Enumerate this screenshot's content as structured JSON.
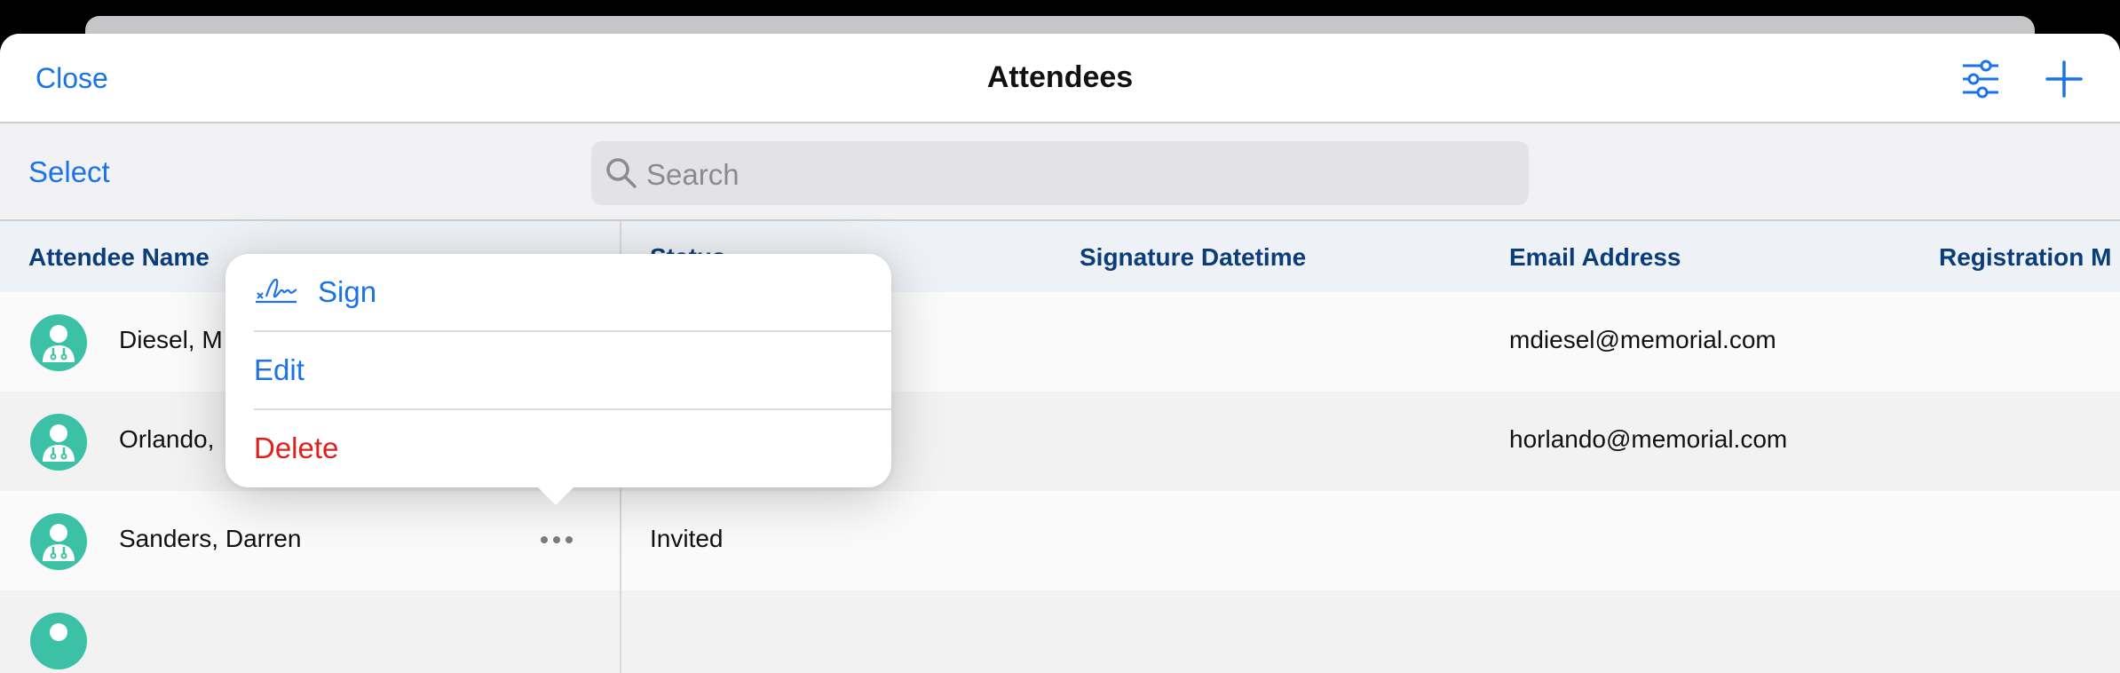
{
  "nav": {
    "close_label": "Close",
    "title": "Attendees"
  },
  "toolbar": {
    "select_label": "Select",
    "search_placeholder": "Search"
  },
  "table": {
    "columns": [
      "Attendee Name",
      "Status",
      "Signature Datetime",
      "Email Address",
      "Registration M"
    ],
    "rows": [
      {
        "name": "Diesel, M",
        "status": "",
        "signature": "",
        "email": "mdiesel@memorial.com"
      },
      {
        "name": "Orlando,",
        "status": "",
        "signature": "",
        "email": "horlando@memorial.com"
      },
      {
        "name": "Sanders, Darren",
        "status": "Invited",
        "signature": "",
        "email": ""
      }
    ]
  },
  "menu": {
    "sign_label": "Sign",
    "edit_label": "Edit",
    "delete_label": "Delete"
  },
  "colors": {
    "accent": "#1a73e8",
    "header_text": "#0a3d7a",
    "danger": "#e0201a",
    "avatar": "#3cc0a6"
  }
}
